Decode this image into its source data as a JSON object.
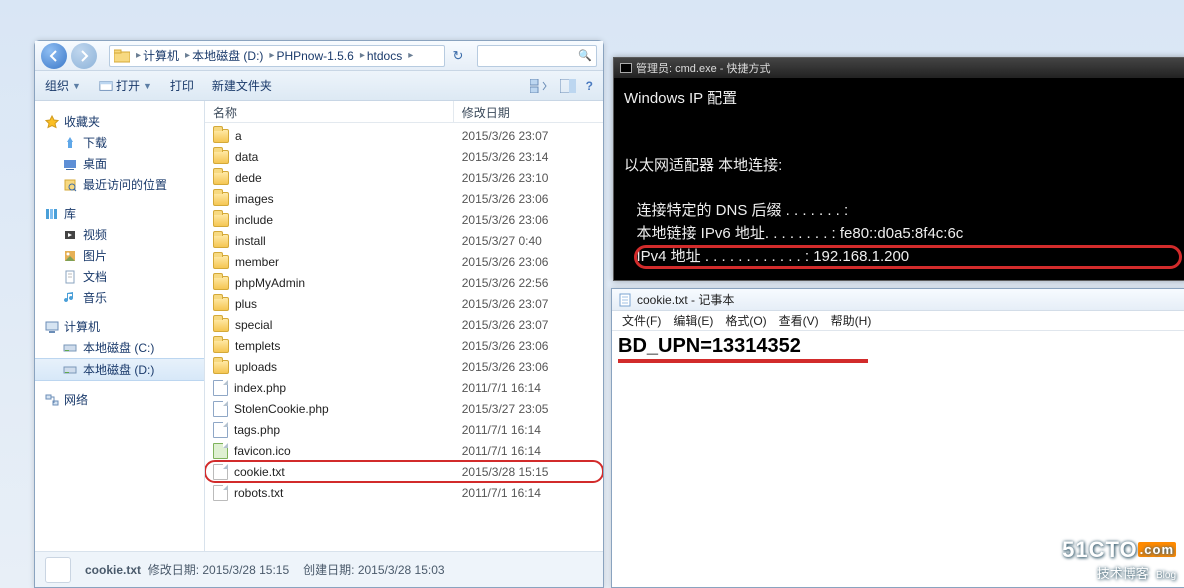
{
  "explorer": {
    "breadcrumbs": [
      "计算机",
      "本地磁盘 (D:)",
      "PHPnow-1.5.6",
      "htdocs"
    ],
    "toolbar": {
      "organize": "组织",
      "open": "打开",
      "print": "打印",
      "newfolder": "新建文件夹"
    },
    "nav": {
      "favorites_head": "收藏夹",
      "favorites": [
        "下载",
        "桌面",
        "最近访问的位置"
      ],
      "lib_head": "库",
      "lib": [
        "视频",
        "图片",
        "文档",
        "音乐"
      ],
      "computer_head": "计算机",
      "computer": [
        "本地磁盘 (C:)",
        "本地磁盘 (D:)"
      ],
      "network_head": "网络"
    },
    "columns": {
      "name": "名称",
      "date": "修改日期"
    },
    "files": [
      {
        "type": "folder",
        "name": "a",
        "date": "2015/3/26 23:07"
      },
      {
        "type": "folder",
        "name": "data",
        "date": "2015/3/26 23:14"
      },
      {
        "type": "folder",
        "name": "dede",
        "date": "2015/3/26 23:10"
      },
      {
        "type": "folder",
        "name": "images",
        "date": "2015/3/26 23:06"
      },
      {
        "type": "folder",
        "name": "include",
        "date": "2015/3/26 23:06"
      },
      {
        "type": "folder",
        "name": "install",
        "date": "2015/3/27 0:40"
      },
      {
        "type": "folder",
        "name": "member",
        "date": "2015/3/26 23:06"
      },
      {
        "type": "folder",
        "name": "phpMyAdmin",
        "date": "2015/3/26 22:56"
      },
      {
        "type": "folder",
        "name": "plus",
        "date": "2015/3/26 23:07"
      },
      {
        "type": "folder",
        "name": "special",
        "date": "2015/3/26 23:07"
      },
      {
        "type": "folder",
        "name": "templets",
        "date": "2015/3/26 23:06"
      },
      {
        "type": "folder",
        "name": "uploads",
        "date": "2015/3/26 23:06"
      },
      {
        "type": "php",
        "name": "index.php",
        "date": "2011/7/1 16:14"
      },
      {
        "type": "php",
        "name": "StolenCookie.php",
        "date": "2015/3/27 23:05"
      },
      {
        "type": "php",
        "name": "tags.php",
        "date": "2011/7/1 16:14"
      },
      {
        "type": "ico",
        "name": "favicon.ico",
        "date": "2011/7/1 16:14"
      },
      {
        "type": "txt",
        "name": "cookie.txt",
        "date": "2015/3/28 15:15",
        "hl": true
      },
      {
        "type": "txt",
        "name": "robots.txt",
        "date": "2011/7/1 16:14"
      }
    ],
    "status": {
      "filename": "cookie.txt",
      "moddate_label": "修改日期:",
      "moddate": "2015/3/28 15:15",
      "created_label": "创建日期:",
      "created": "2015/3/28 15:03"
    }
  },
  "cmd": {
    "title": "管理员: cmd.exe - 快捷方式",
    "l1": "Windows IP 配置",
    "l2": "以太网适配器 本地连接:",
    "l3": "   连接特定的 DNS 后缀 . . . . . . . :",
    "l4": "   本地链接 IPv6 地址. . . . . . . . : fe80::d0a5:8f4c:6c",
    "l5": "   IPv4 地址 . . . . . . . . . . . . : 192.168.1.200"
  },
  "notepad": {
    "title": "cookie.txt - 记事本",
    "menu": [
      "文件(F)",
      "编辑(E)",
      "格式(O)",
      "查看(V)",
      "帮助(H)"
    ],
    "content": "BD_UPN=13314352"
  },
  "watermark": {
    "l1a": "51CTO",
    "l1b": ".com",
    "l2": "技术博客",
    "l2b": "Blog"
  }
}
